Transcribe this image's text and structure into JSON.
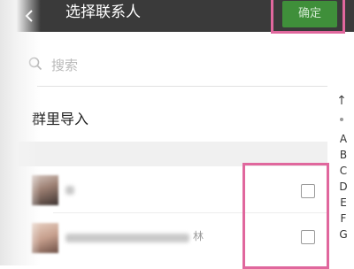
{
  "header": {
    "title": "选择联系人",
    "confirm_label": "确定"
  },
  "search": {
    "placeholder": "搜索"
  },
  "import_group": {
    "label": "群里导入"
  },
  "contacts": [
    {
      "name_hint": "",
      "checked": false
    },
    {
      "name_hint": "林",
      "checked": false
    }
  ],
  "index_bar": {
    "up_arrow": "↑",
    "letters": [
      "A",
      "B",
      "C",
      "D",
      "E",
      "F",
      "G"
    ]
  },
  "colors": {
    "header_bg": "#3a3a3a",
    "confirm_bg": "#3f8f3a",
    "highlight": "#e0679d"
  }
}
